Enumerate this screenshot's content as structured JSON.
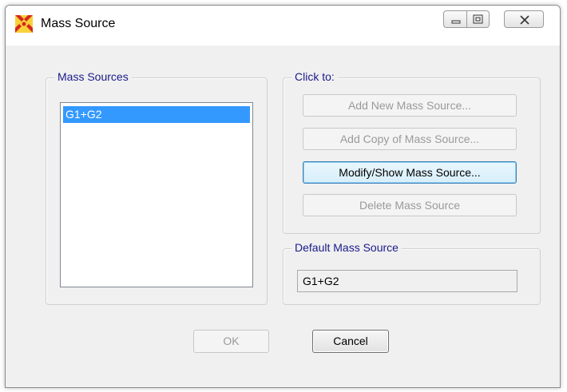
{
  "window": {
    "title": "Mass Source",
    "controls": {
      "minimize": "minimize",
      "maximize": "maximize",
      "close": "close"
    }
  },
  "mass_sources": {
    "label": "Mass Sources",
    "items": [
      "G1+G2"
    ],
    "selected_index": 0
  },
  "click_to": {
    "label": "Click to:",
    "buttons": {
      "add_new": "Add New Mass Source...",
      "add_copy": "Add Copy of Mass Source...",
      "modify_show": "Modify/Show Mass Source...",
      "delete": "Delete Mass Source"
    }
  },
  "default_mass_source": {
    "label": "Default Mass Source",
    "value": "G1+G2"
  },
  "footer": {
    "ok_label": "OK",
    "cancel_label": "Cancel"
  },
  "colors": {
    "group_label": "#1a1a8c",
    "selection": "#3399ff",
    "disabled_text": "#9a9a9a"
  }
}
